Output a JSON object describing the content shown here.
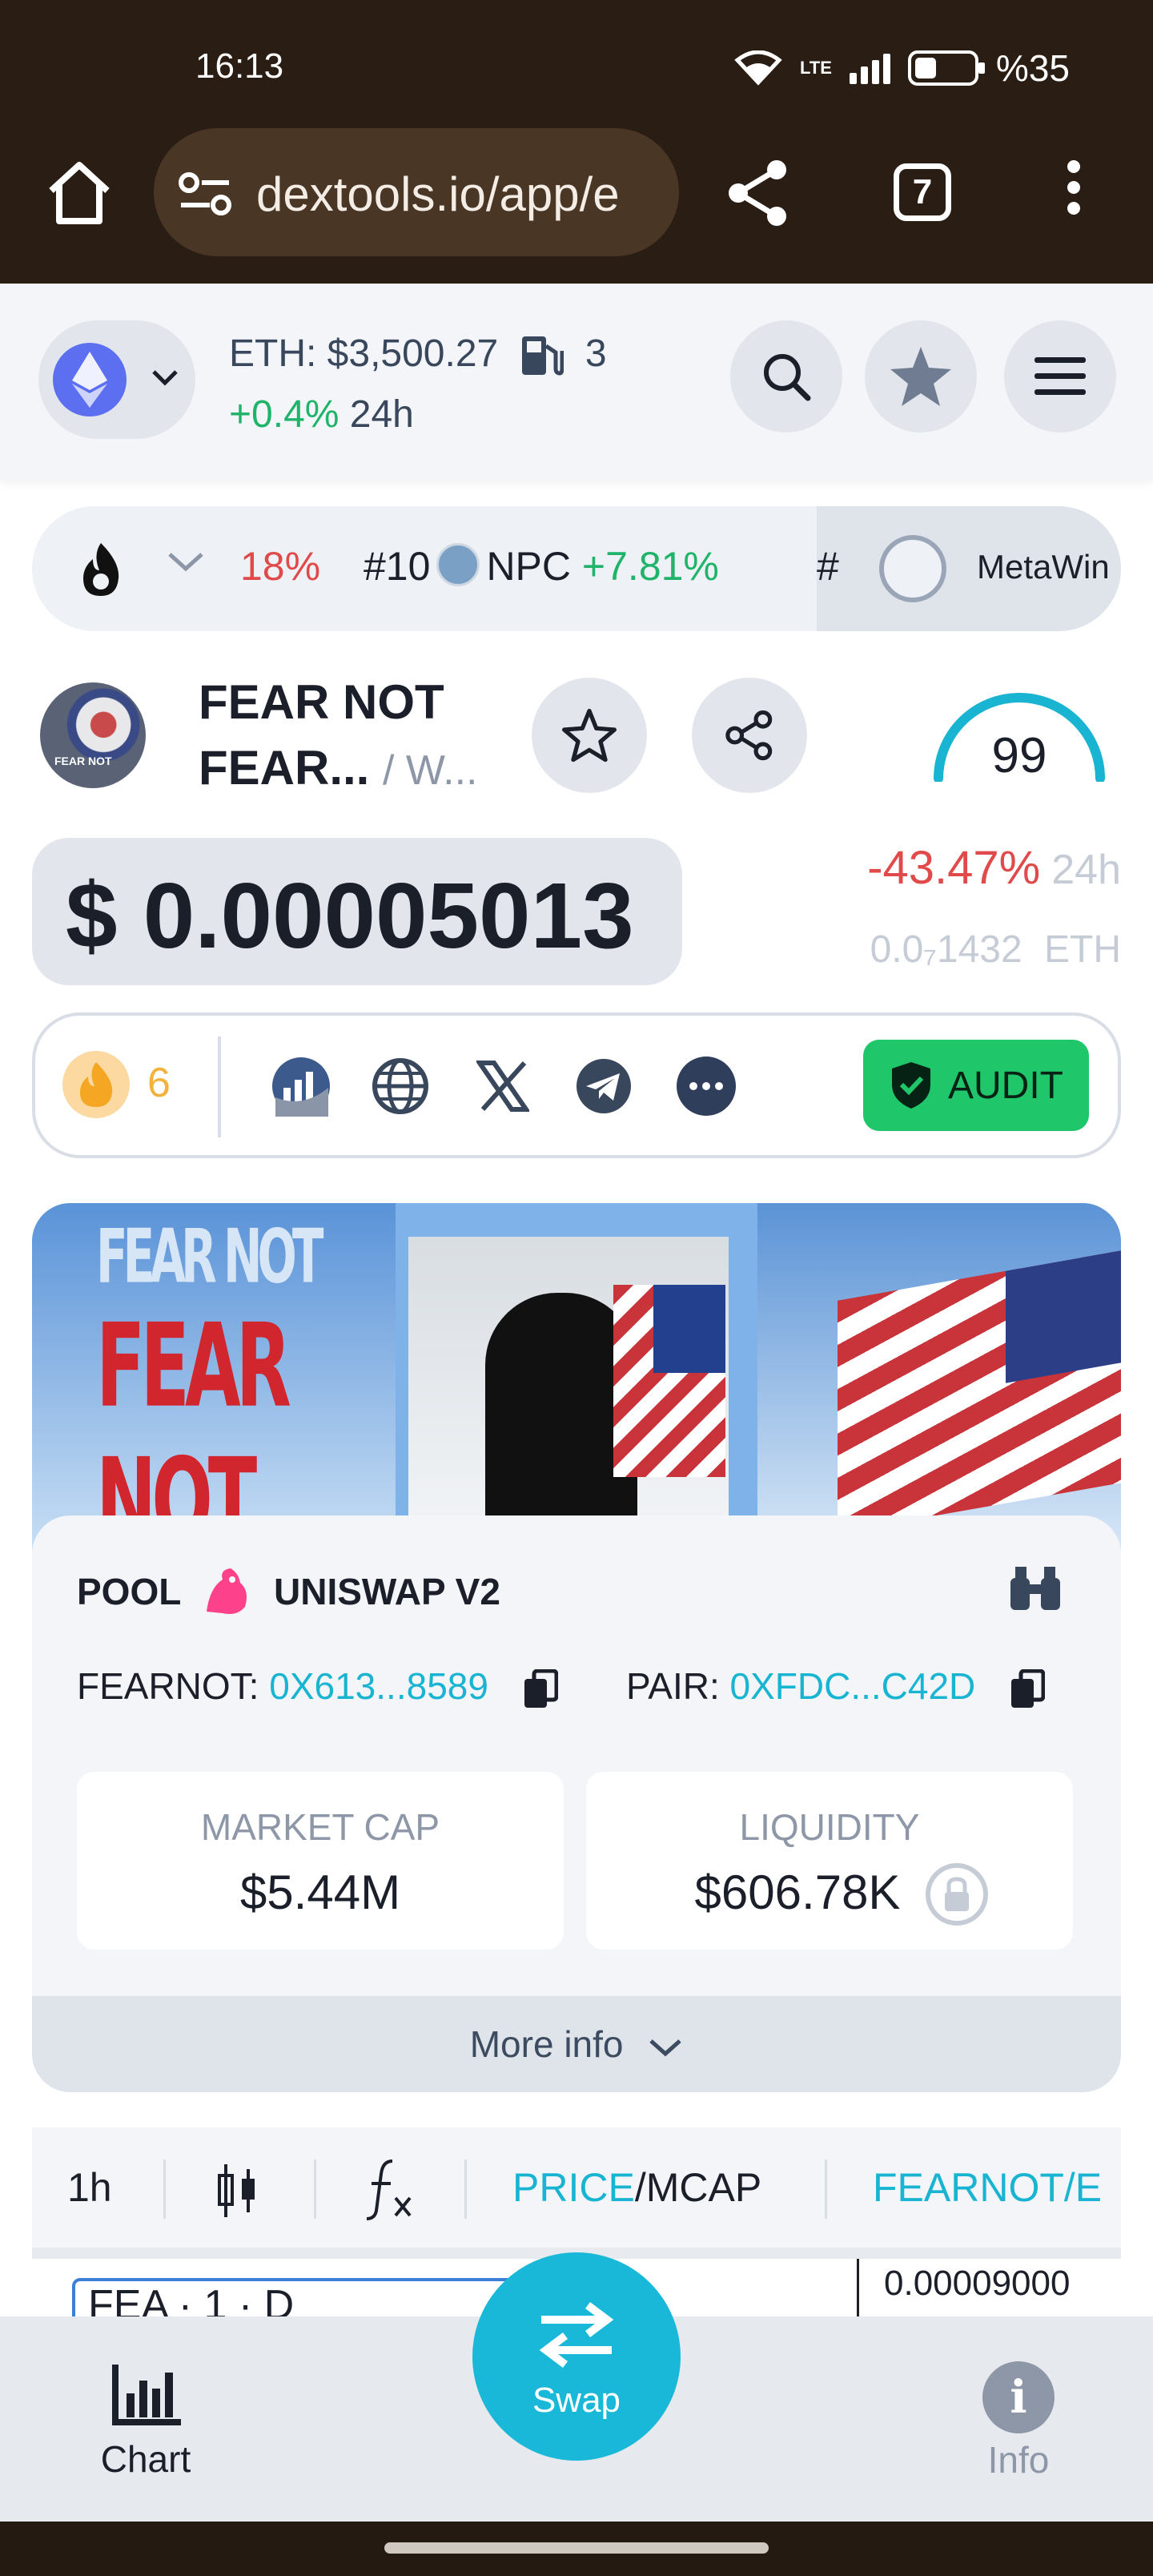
{
  "status_bar": {
    "time": "16:13",
    "network": "LTE",
    "battery": "%35"
  },
  "browser": {
    "url": "dextools.io/app/e",
    "tab_count": "7"
  },
  "header": {
    "eth_price_label": "ETH: $3,500.27",
    "gas_value": "3",
    "eth_change": "+0.4%",
    "eth_change_period": "24h"
  },
  "ticker": {
    "first_change": "18%",
    "item2_rank": "#10",
    "item2_name": "NPC",
    "item2_change": "+7.81%",
    "item3_rank": "#",
    "sponsor": "MetaWin"
  },
  "token": {
    "avatar_text": "FEAR NOT",
    "name_line1": "FEAR NOT",
    "name_line2": "FEAR...",
    "pair_short": "/ W...",
    "score": "99",
    "price": "$ 0.00005013",
    "change": "-43.47%",
    "change_period": "24h",
    "eth_price": "0.0₇1432",
    "eth_unit": "ETH"
  },
  "social": {
    "hot_count": "6",
    "audit_label": "AUDIT"
  },
  "banner": {
    "text1": "FEAR NOT",
    "text2": "FEAR NOT"
  },
  "pool": {
    "label": "POOL",
    "dex": "UNISWAP V2",
    "token_label": "FEARNOT:",
    "token_address": "0X613...8589",
    "pair_label": "PAIR:",
    "pair_address": "0XFDC...C42D",
    "market_cap_label": "MARKET CAP",
    "market_cap": "$5.44M",
    "liquidity_label": "LIQUIDITY",
    "liquidity": "$606.78K",
    "more_info": "More info"
  },
  "chart_toolbar": {
    "interval": "1h",
    "price": "PRICE",
    "mcap": "/MCAP",
    "pair": "FEARNOT/E"
  },
  "chart": {
    "legend": "FEA  · 1 · D",
    "axis_top": "0.00009000"
  },
  "bottom_nav": {
    "chart": "Chart",
    "swap": "Swap",
    "info": "Info"
  },
  "colors": {
    "accent": "#19b4d1",
    "up": "#1fb46a",
    "down": "#e04a4a",
    "audit": "#1fc76a"
  }
}
